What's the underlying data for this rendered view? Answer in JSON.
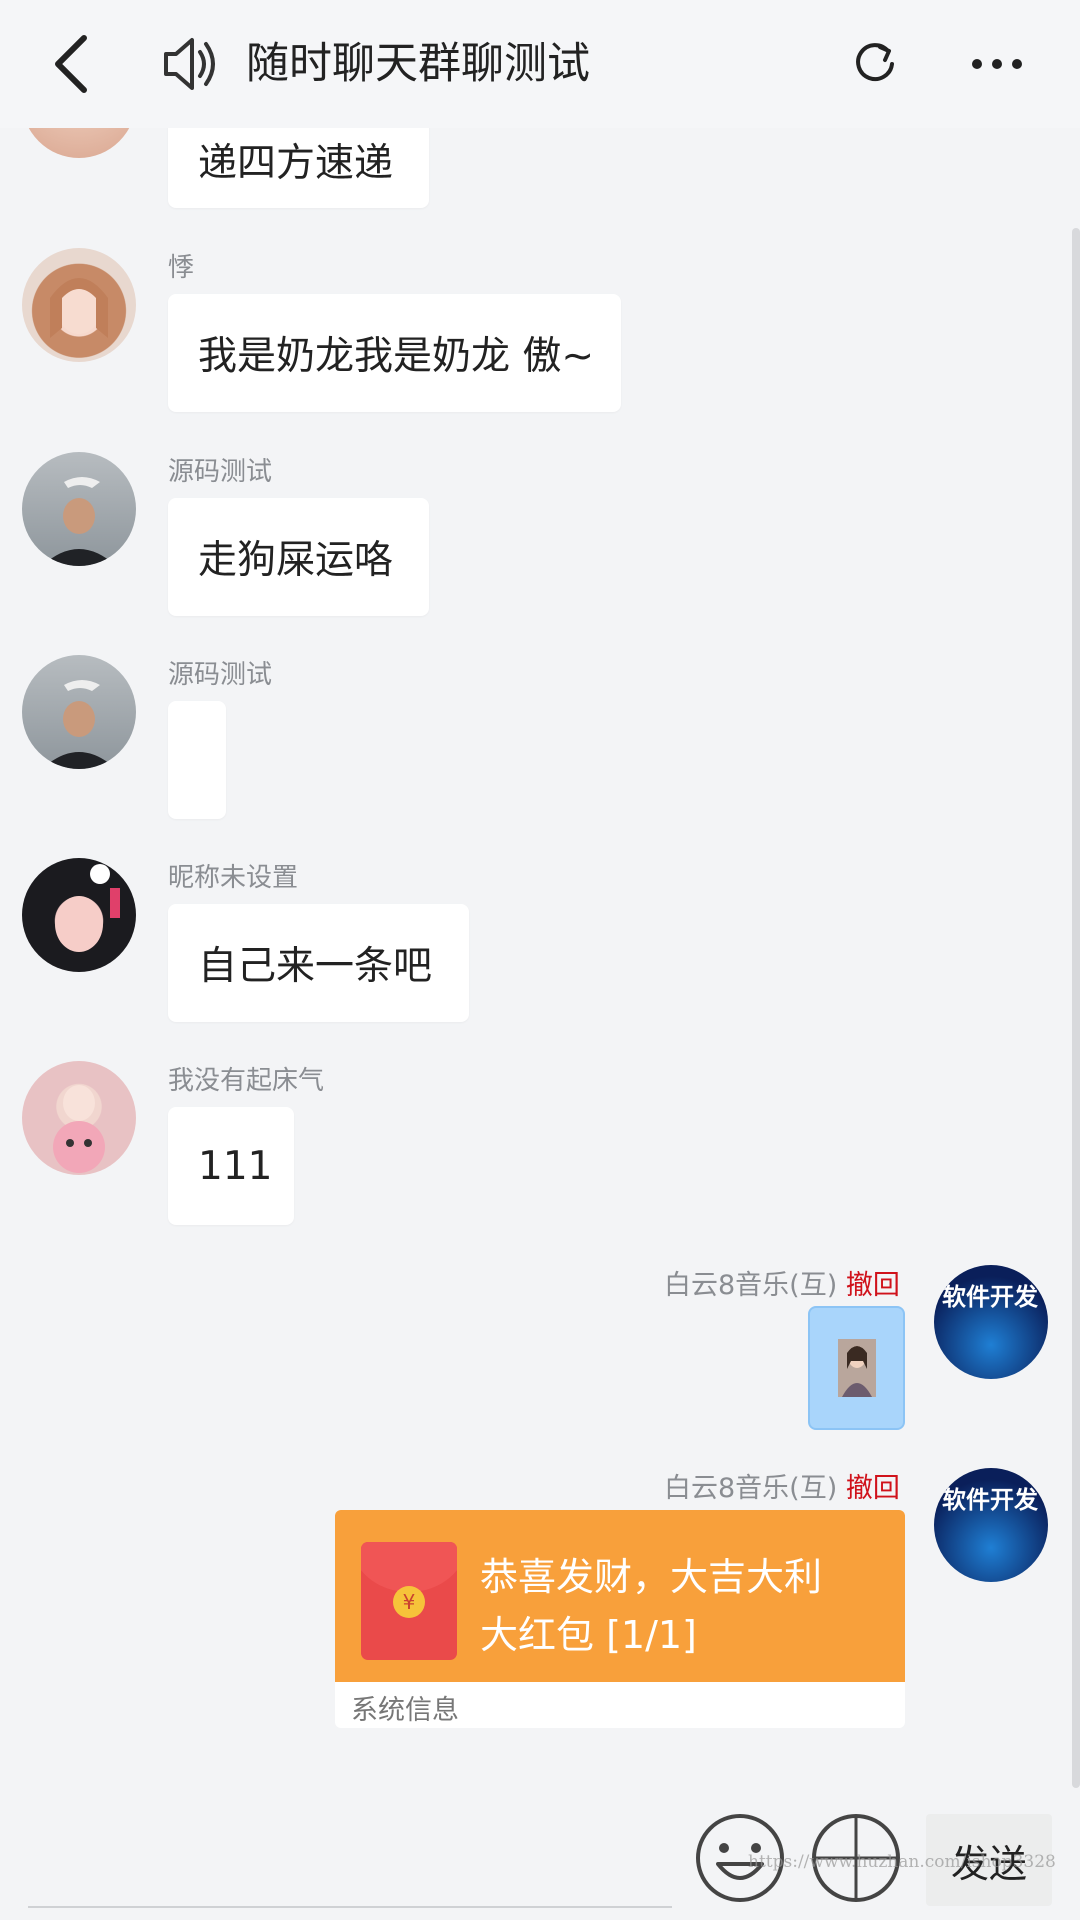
{
  "header": {
    "title": "随时聊天群聊测试",
    "back_icon": "chevron-left-icon",
    "speaker_icon": "speaker-icon",
    "refresh_icon": "refresh-icon",
    "more_icon": "more-icon"
  },
  "messages": [
    {
      "sender": "",
      "text": "递四方速递"
    },
    {
      "sender": "悸",
      "text": "我是奶龙我是奶龙 傲~"
    },
    {
      "sender": "源码测试",
      "text": "走狗屎运咯"
    },
    {
      "sender": "源码测试",
      "text": ""
    },
    {
      "sender": "昵称未设置",
      "text": "自己来一条吧"
    },
    {
      "sender": "我没有起床气",
      "text": "111"
    }
  ],
  "own_messages": [
    {
      "sender": "白云8音乐(互)",
      "recall": "撤回",
      "type": "image"
    },
    {
      "sender": "白云8音乐(互)",
      "recall": "撤回",
      "type": "red-packet",
      "red_packet": {
        "title": "恭喜发财，大吉大利",
        "subtitle": "大红包 [1/1]",
        "footer": "系统信息",
        "coin": "¥"
      }
    }
  ],
  "avatar_text": "软件开发",
  "toolbar": {
    "send_label": "发送"
  },
  "watermark": "https://www.huzhan.com/ishop3328",
  "colors": {
    "accent_orange": "#f8a03b",
    "recall_red": "#d0121b",
    "image_bubble": "#a9d5fb",
    "background": "#f3f4f6"
  }
}
